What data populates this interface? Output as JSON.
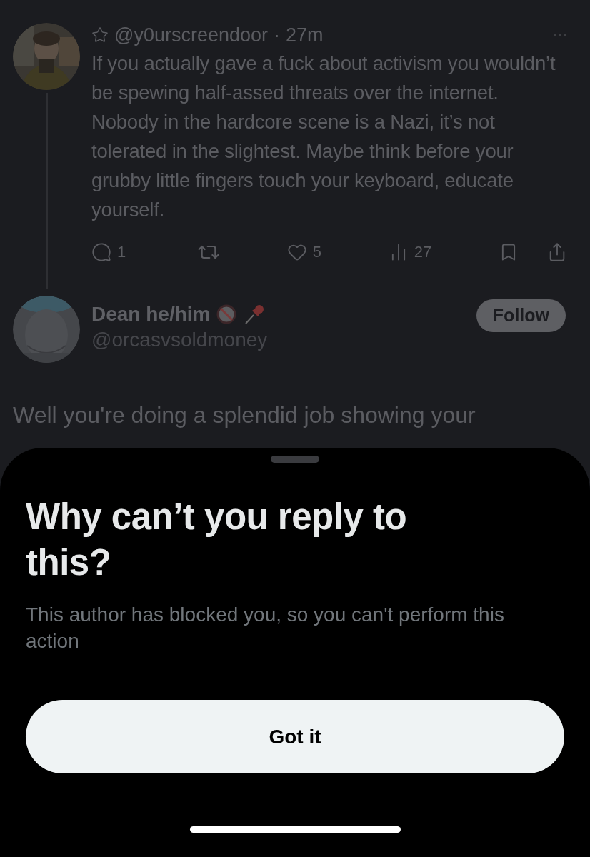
{
  "reply_tweet": {
    "handle": "@y0urscreendoor",
    "separator": "·",
    "time": "27m",
    "text": "If you actually gave a fuck about activism you wouldn’t be spewing half-assed threats over the internet. Nobody in the hardcore scene is a Nazi, it’s not tolerated in the slightest. Maybe think before your grubby little fingers touch your keyboard, educate yourself.",
    "reply_count": "1",
    "like_count": "5",
    "view_count": "27"
  },
  "main_tweet": {
    "display_name": "Dean he/him",
    "handle": "@orcasvsoldmoney",
    "follow_label": "Follow",
    "text": "Well you're doing a splendid job showing your"
  },
  "sheet": {
    "title": "Why can’t you reply to this?",
    "body": "This author has blocked you, so you can't perform this action",
    "button": "Got it"
  }
}
